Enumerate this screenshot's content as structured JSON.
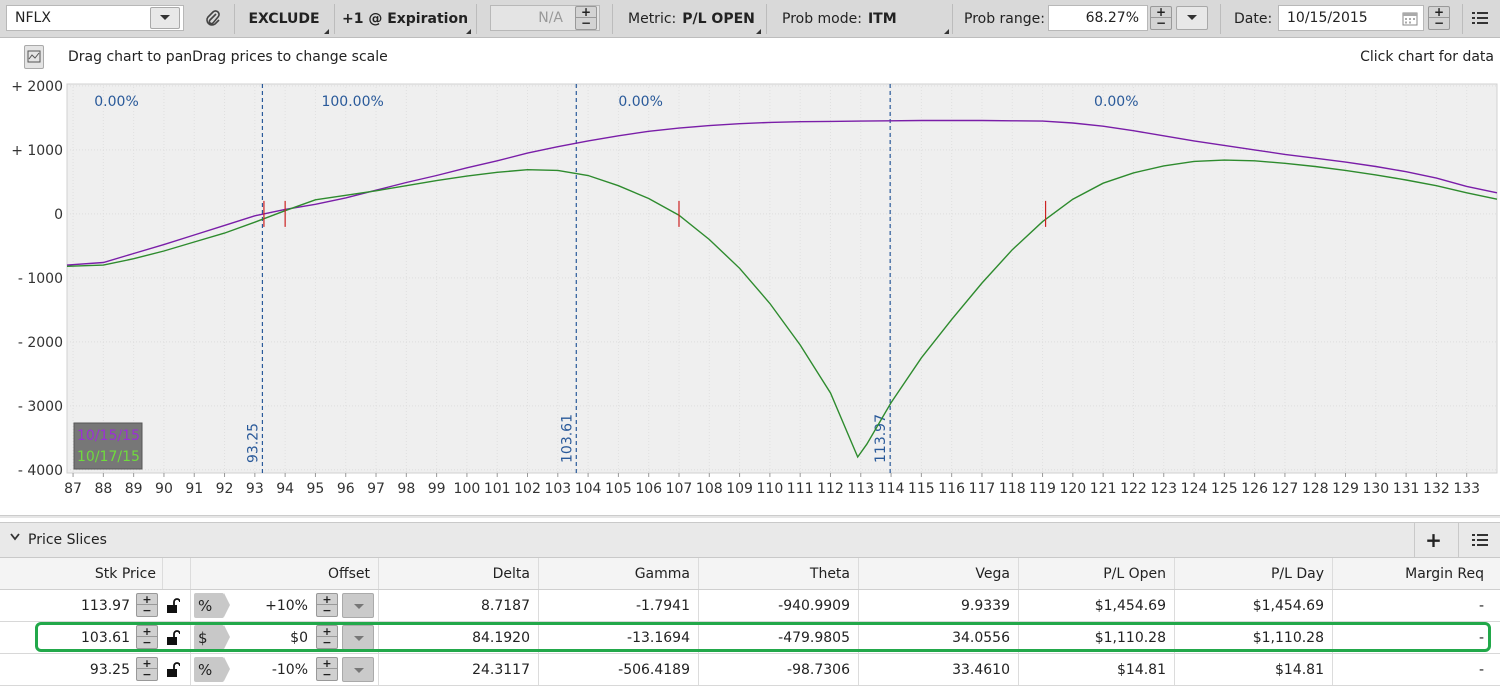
{
  "toolbar": {
    "symbol": "NFLX",
    "exclude_label": "EXCLUDE",
    "expiration_label": "+1 @ Expiration",
    "na_value": "N/A",
    "metric_label": "Metric:",
    "metric_value": "P/L OPEN",
    "prob_mode_label": "Prob mode:",
    "prob_mode_value": "ITM",
    "prob_range_label": "Prob range:",
    "prob_range_value": "68.27%",
    "date_label": "Date:",
    "date_value": "10/15/2015"
  },
  "chart_hint": {
    "left": "Drag chart to panDrag prices to change scale",
    "right": "Click chart for data"
  },
  "chart_data": {
    "type": "line",
    "x": [
      87,
      88,
      89,
      90,
      91,
      92,
      93,
      94,
      95,
      96,
      97,
      98,
      99,
      100,
      101,
      102,
      103,
      104,
      105,
      106,
      107,
      108,
      109,
      110,
      111,
      112,
      113,
      114,
      115,
      116,
      117,
      118,
      119,
      120,
      121,
      122,
      123,
      124,
      125,
      126,
      127,
      128,
      129,
      130,
      131,
      132,
      133
    ],
    "xlim": [
      86.8,
      134.0
    ],
    "ylim": [
      -4050,
      2030
    ],
    "y_ticks": [
      "+ 2000",
      "+ 1000",
      "0",
      "- 1000",
      "- 2000",
      "- 3000",
      "- 4000"
    ],
    "y_tick_values": [
      2000,
      1000,
      0,
      -1000,
      -2000,
      -3000,
      -4000
    ],
    "x_ticks": [
      "87",
      "88",
      "89",
      "90",
      "91",
      "92",
      "93",
      "94",
      "95",
      "96",
      "97",
      "98",
      "99",
      "100",
      "101",
      "102",
      "103",
      "104",
      "105",
      "106",
      "107",
      "108",
      "109",
      "110",
      "111",
      "112",
      "113",
      "114",
      "115",
      "116",
      "117",
      "118",
      "119",
      "120",
      "121",
      "122",
      "123",
      "124",
      "125",
      "126",
      "127",
      "128",
      "129",
      "130",
      "131",
      "132",
      "133"
    ],
    "series": [
      {
        "name": "10/15/15",
        "color": "#7a1ea8",
        "points": [
          [
            86.8,
            -800
          ],
          [
            88,
            -760
          ],
          [
            89,
            -620
          ],
          [
            90,
            -480
          ],
          [
            91,
            -330
          ],
          [
            92,
            -180
          ],
          [
            93,
            -30
          ],
          [
            94,
            70
          ],
          [
            95,
            150
          ],
          [
            96,
            250
          ],
          [
            97,
            370
          ],
          [
            98,
            490
          ],
          [
            99,
            600
          ],
          [
            100,
            720
          ],
          [
            101,
            830
          ],
          [
            102,
            950
          ],
          [
            103,
            1050
          ],
          [
            104,
            1140
          ],
          [
            105,
            1220
          ],
          [
            106,
            1290
          ],
          [
            107,
            1340
          ],
          [
            108,
            1380
          ],
          [
            109,
            1410
          ],
          [
            110,
            1430
          ],
          [
            111,
            1440
          ],
          [
            112,
            1445
          ],
          [
            113,
            1450
          ],
          [
            114,
            1455
          ],
          [
            115,
            1460
          ],
          [
            116,
            1460
          ],
          [
            117,
            1460
          ],
          [
            118,
            1455
          ],
          [
            119,
            1450
          ],
          [
            120,
            1420
          ],
          [
            121,
            1370
          ],
          [
            122,
            1300
          ],
          [
            123,
            1220
          ],
          [
            124,
            1140
          ],
          [
            125,
            1070
          ],
          [
            126,
            1000
          ],
          [
            127,
            930
          ],
          [
            128,
            870
          ],
          [
            129,
            810
          ],
          [
            130,
            740
          ],
          [
            131,
            660
          ],
          [
            132,
            560
          ],
          [
            133,
            430
          ],
          [
            134,
            330
          ]
        ]
      },
      {
        "name": "10/17/15",
        "color": "#2e8b2e",
        "points": [
          [
            86.8,
            -820
          ],
          [
            88,
            -800
          ],
          [
            89,
            -700
          ],
          [
            90,
            -580
          ],
          [
            91,
            -440
          ],
          [
            92,
            -300
          ],
          [
            93,
            -130
          ],
          [
            94,
            50
          ],
          [
            95,
            220
          ],
          [
            96,
            290
          ],
          [
            97,
            360
          ],
          [
            98,
            440
          ],
          [
            99,
            520
          ],
          [
            100,
            590
          ],
          [
            101,
            650
          ],
          [
            102,
            690
          ],
          [
            103,
            680
          ],
          [
            104,
            600
          ],
          [
            105,
            440
          ],
          [
            106,
            240
          ],
          [
            107,
            -20
          ],
          [
            108,
            -400
          ],
          [
            109,
            -850
          ],
          [
            110,
            -1400
          ],
          [
            111,
            -2050
          ],
          [
            112,
            -2800
          ],
          [
            112.9,
            -3800
          ],
          [
            113.2,
            -3600
          ],
          [
            114,
            -2950
          ],
          [
            115,
            -2250
          ],
          [
            116,
            -1650
          ],
          [
            117,
            -1080
          ],
          [
            118,
            -560
          ],
          [
            119,
            -120
          ],
          [
            120,
            230
          ],
          [
            121,
            480
          ],
          [
            122,
            640
          ],
          [
            123,
            750
          ],
          [
            124,
            820
          ],
          [
            125,
            840
          ],
          [
            126,
            830
          ],
          [
            127,
            790
          ],
          [
            128,
            740
          ],
          [
            129,
            680
          ],
          [
            130,
            610
          ],
          [
            131,
            530
          ],
          [
            132,
            440
          ],
          [
            133,
            330
          ],
          [
            134,
            230
          ]
        ]
      }
    ],
    "slices": [
      {
        "x": 93.25,
        "label": "93.25"
      },
      {
        "x": 103.61,
        "label": "103.61"
      },
      {
        "x": 113.97,
        "label": "113.97"
      }
    ],
    "zone_labels": [
      {
        "x": 87.7,
        "text": "0.00%"
      },
      {
        "x": 95.2,
        "text": "100.00%"
      },
      {
        "x": 105.0,
        "text": "0.00%"
      },
      {
        "x": 120.7,
        "text": "0.00%"
      }
    ],
    "breakeven_marks": [
      93.3,
      94.0,
      107.0,
      119.1
    ],
    "legend": [
      "10/15/15",
      "10/17/15"
    ]
  },
  "price_slices": {
    "title": "Price Slices",
    "columns": [
      "Stk Price",
      "Offset",
      "Delta",
      "Gamma",
      "Theta",
      "Vega",
      "P/L Open",
      "P/L Day",
      "Margin Req"
    ],
    "rows": [
      {
        "stk": "113.97",
        "type": "%",
        "offset": "+10%",
        "delta": "8.7187",
        "gamma": "-1.7941",
        "theta": "-940.9909",
        "vega": "9.9339",
        "pl_open": "$1,454.69",
        "pl_day": "$1,454.69",
        "margin": "-"
      },
      {
        "stk": "103.61",
        "type": "$",
        "offset": "$0",
        "delta": "84.1920",
        "gamma": "-13.1694",
        "theta": "-479.9805",
        "vega": "34.0556",
        "pl_open": "$1,110.28",
        "pl_day": "$1,110.28",
        "margin": "-"
      },
      {
        "stk": "93.25",
        "type": "%",
        "offset": "-10%",
        "delta": "24.3117",
        "gamma": "-506.4189",
        "theta": "-98.7306",
        "vega": "33.4610",
        "pl_open": "$14.81",
        "pl_day": "$14.81",
        "margin": "-"
      }
    ]
  },
  "colors": {
    "highlight": "#22a84a",
    "slice_line": "#2a5a9a",
    "breakeven": "#cc2222"
  }
}
